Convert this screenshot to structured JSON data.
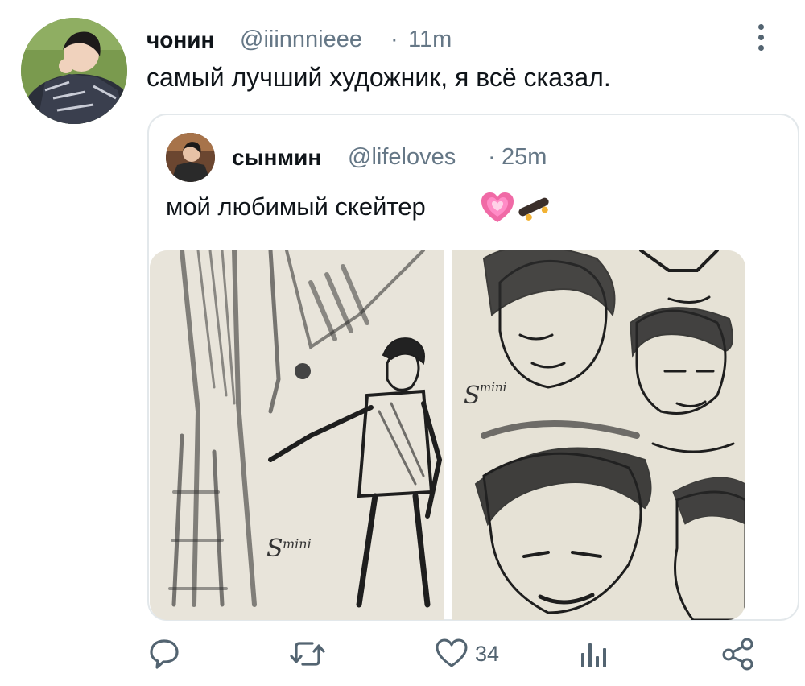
{
  "tweet": {
    "display_name": "чонин",
    "handle": "@iiinnnieee",
    "separator": "·",
    "time": "11m",
    "text": "самый лучший художник, я всё сказал."
  },
  "quoted_tweet": {
    "display_name": "сынмин",
    "handle": "@lifeloves",
    "separator": "·",
    "time": "25m",
    "text": "мой любимый скейтер",
    "emojis": [
      "growing-heart-icon",
      "skateboard-icon"
    ]
  },
  "actions": {
    "like_count": "34"
  },
  "colors": {
    "text_primary": "#0f1419",
    "text_secondary": "#657786",
    "icon": "#536471",
    "border": "#e3e8eb"
  }
}
